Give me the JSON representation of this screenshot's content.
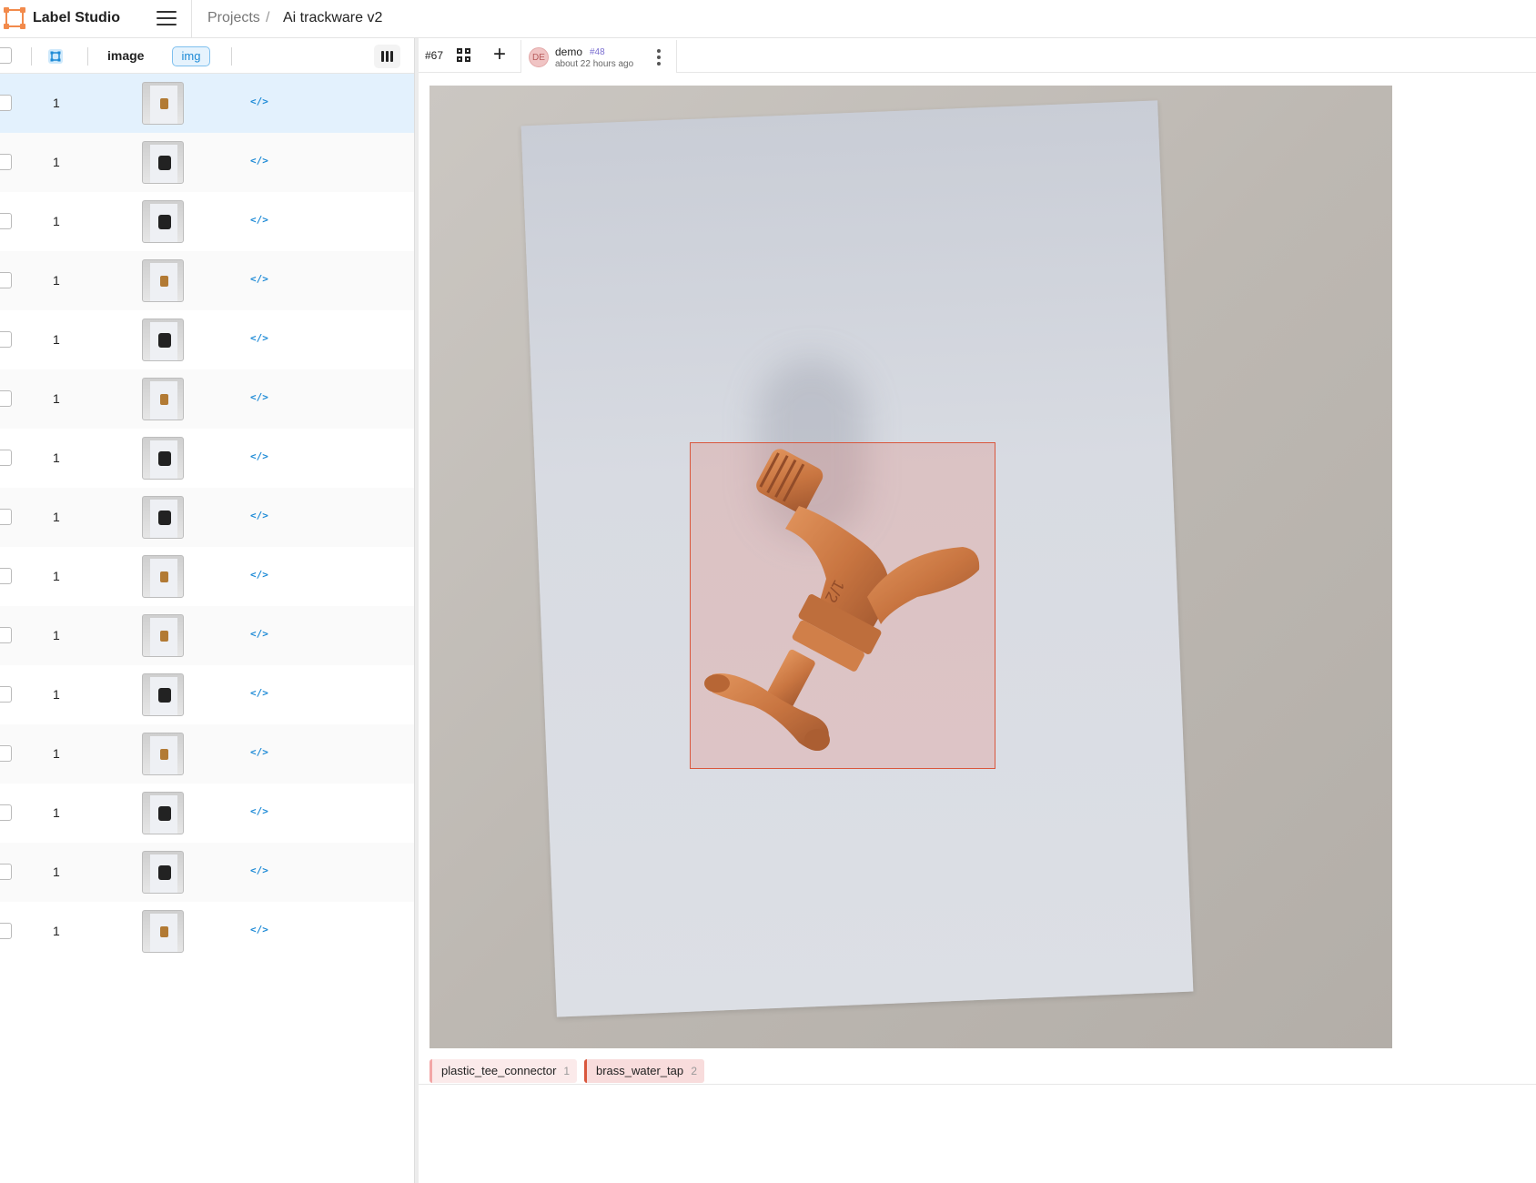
{
  "app": {
    "title": "Label Studio"
  },
  "breadcrumb": {
    "projects": "Projects",
    "separator": "/",
    "current": "Ai trackware v2"
  },
  "table": {
    "header": {
      "image_col": "image",
      "img_badge": "img"
    },
    "rows": [
      {
        "count": "1",
        "thumb": "brass",
        "link": "</>",
        "selected": true
      },
      {
        "count": "1",
        "thumb": "dark",
        "link": "</>"
      },
      {
        "count": "1",
        "thumb": "dark",
        "link": "</>"
      },
      {
        "count": "1",
        "thumb": "brass",
        "link": "</>"
      },
      {
        "count": "1",
        "thumb": "dark",
        "link": "</>"
      },
      {
        "count": "1",
        "thumb": "brass",
        "link": "</>"
      },
      {
        "count": "1",
        "thumb": "dark",
        "link": "</>"
      },
      {
        "count": "1",
        "thumb": "dark",
        "link": "</>"
      },
      {
        "count": "1",
        "thumb": "brass",
        "link": "</>"
      },
      {
        "count": "1",
        "thumb": "brass",
        "link": "</>"
      },
      {
        "count": "1",
        "thumb": "dark",
        "link": "</>"
      },
      {
        "count": "1",
        "thumb": "brass",
        "link": "</>"
      },
      {
        "count": "1",
        "thumb": "dark",
        "link": "</>"
      },
      {
        "count": "1",
        "thumb": "dark",
        "link": "</>"
      },
      {
        "count": "1",
        "thumb": "brass",
        "link": "</>"
      }
    ]
  },
  "annotation": {
    "task_id": "#67",
    "user_initials": "DE",
    "user_name": "demo",
    "annotation_id": "#48",
    "time": "about 22 hours ago"
  },
  "labels": [
    {
      "name": "plastic_tee_connector",
      "hotkey": "1",
      "color": "#f3a6a6"
    },
    {
      "name": "brass_water_tap",
      "hotkey": "2",
      "color": "#d9573d"
    }
  ]
}
